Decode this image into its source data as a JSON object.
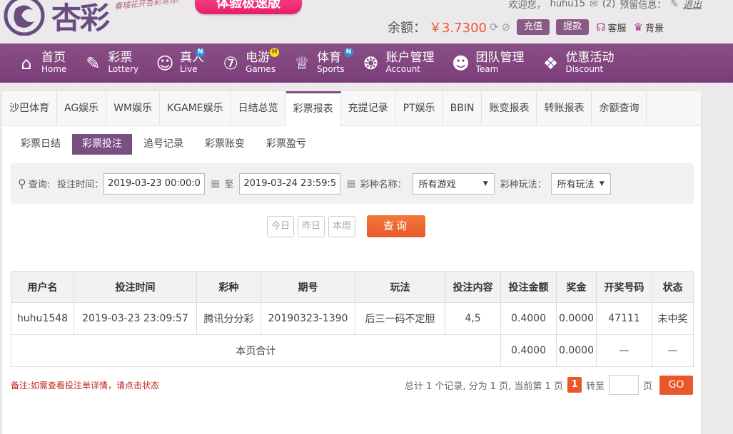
{
  "header": {
    "logo_text": "杏彩",
    "slogan": "春城花开杏彩常你!",
    "promo_label": "体验极速版",
    "welcome": "欢迎您，",
    "username": "huhu15",
    "messages_count": "(2)",
    "notice_label": "预留信息：",
    "logout_label": "退出",
    "balance_label": "余额：",
    "balance_value": "￥3.7300",
    "recharge_label": "充值",
    "withdraw_label": "提款",
    "service_label": "客服",
    "background_label": "背景"
  },
  "nav": [
    {
      "zh": "首页",
      "en": "Home",
      "icon": "home-icon",
      "badge": ""
    },
    {
      "zh": "彩票",
      "en": "Lottery",
      "icon": "ticket-icon",
      "badge": ""
    },
    {
      "zh": "真人",
      "en": "Live",
      "icon": "dealer-icon",
      "badge": "N"
    },
    {
      "zh": "电游",
      "en": "Games",
      "icon": "seven-icon",
      "badge": "H"
    },
    {
      "zh": "体育",
      "en": "Sports",
      "icon": "trophy-icon",
      "badge": "N"
    },
    {
      "zh": "账户管理",
      "en": "Account",
      "icon": "account-icon",
      "badge": ""
    },
    {
      "zh": "团队管理",
      "en": "Team",
      "icon": "team-icon",
      "badge": ""
    },
    {
      "zh": "优惠活动",
      "en": "Discount",
      "icon": "gift-icon",
      "badge": ""
    }
  ],
  "tabs": [
    "沙巴体育",
    "AG娱乐",
    "WM娱乐",
    "KGAME娱乐",
    "日结总览",
    "彩票报表",
    "充提记录",
    "PT娱乐",
    "BBIN",
    "账变报表",
    "转账报表",
    "余额查询"
  ],
  "active_tab": 5,
  "subtabs": [
    "彩票日结",
    "彩票投注",
    "追号记录",
    "彩票账变",
    "彩票盈亏"
  ],
  "active_subtab": 1,
  "query": {
    "search_label": "查询:",
    "time_label": "投注时间：",
    "start_time": "2019-03-23 00:00:00",
    "to_label": "至",
    "end_time": "2019-03-24 23:59:59",
    "game_label": "彩种名称：",
    "game_value": "所有游戏",
    "play_label": "彩种玩法：",
    "play_value": "所有玩法",
    "today": "今日",
    "yesterday": "昨日",
    "week": "本周",
    "search_button": "查询"
  },
  "table": {
    "headers": [
      "用户名",
      "投注时间",
      "彩种",
      "期号",
      "玩法",
      "投注内容",
      "投注金额",
      "奖金",
      "开奖号码",
      "状态"
    ],
    "rows": [
      [
        "huhu1548",
        "2019-03-23 23:09:57",
        "腾讯分分彩",
        "20190323-1390",
        "后三一码不定胆",
        "4,5",
        "0.4000",
        "0.0000",
        "47111",
        "未中奖"
      ]
    ],
    "summary": {
      "label": "本页合计",
      "amount": "0.4000",
      "bonus": "0.0000",
      "code": "—",
      "status": "—"
    }
  },
  "note": "备注:如需查看投注单详情，请点击状态",
  "pager": {
    "summary": "总计 1 个记录, 分为 1 页, 当前第 1 页",
    "current": "1",
    "goto_label": "转至",
    "page_unit": "页",
    "go_label": "GO"
  }
}
